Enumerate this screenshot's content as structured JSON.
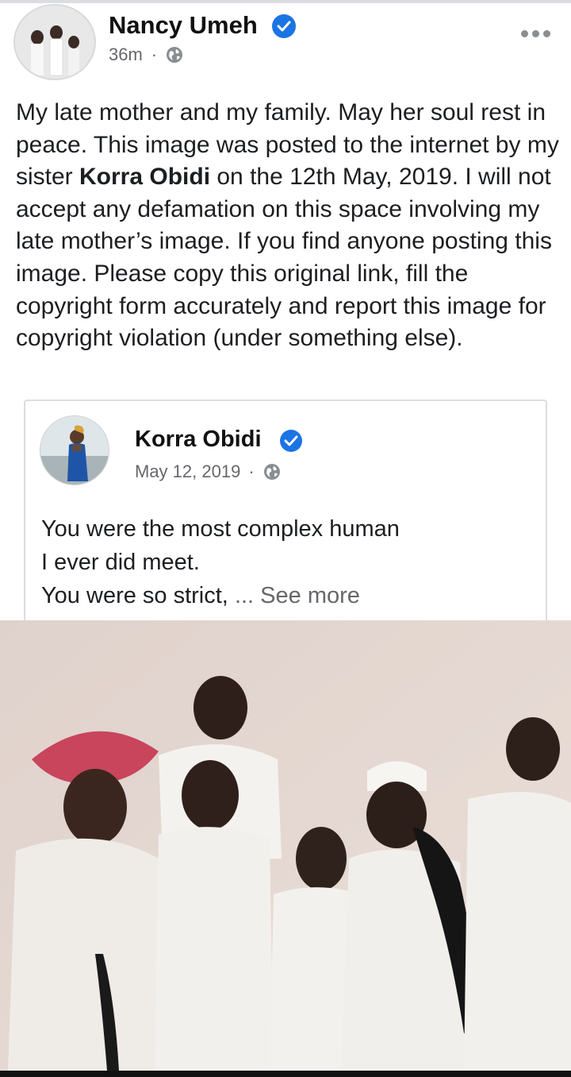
{
  "post": {
    "author": "Nancy Umeh",
    "time": "36m",
    "separator": "·",
    "text_part1": "My late mother and my family. May her soul rest in peace. This image was posted to the internet by my sister ",
    "mention": "Korra Obidi",
    "text_part2": " on the 12th May, 2019. I will not accept any defamation on this space involving my late mother’s image. If you find anyone posting this image. Please copy this original link, fill the copyright form accurately and report this image for copyright violation (under something else)."
  },
  "shared_post": {
    "author": "Korra Obidi",
    "date": "May 12, 2019",
    "separator": "·",
    "line1": "You were the most complex human",
    "line2": "I ever did meet.",
    "line3": "You were so strict, ",
    "see_more": "... See more"
  },
  "icons": {
    "verified": "verified-badge-icon",
    "audience": "globe-icon",
    "more": "more-options-icon"
  },
  "colors": {
    "verified_blue": "#1b74e4",
    "meta_gray": "#65676b"
  }
}
